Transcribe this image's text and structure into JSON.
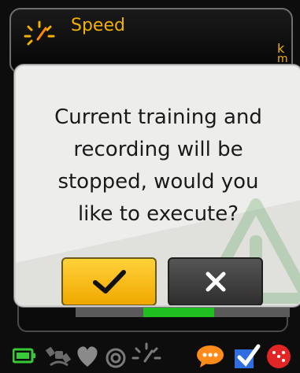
{
  "header": {
    "metric_label": "Speed",
    "metric_icon": "speed-gauge-icon",
    "unit_line1": "k",
    "unit_line2": "m"
  },
  "progress": {
    "fill_fraction": 0.33,
    "color": "#1fbf1f"
  },
  "dialog": {
    "message_lines": [
      "Current training and",
      "recording will be",
      "stopped, would you",
      "like to execute?"
    ],
    "watermark_icon": "warning-triangle-icon"
  },
  "buttons": {
    "confirm_icon": "checkmark-icon",
    "cancel_icon": "close-x-icon",
    "confirm_color": "#f7c21a",
    "cancel_color": "#3a3a3a"
  },
  "statusbar": {
    "icons": [
      "battery-icon",
      "satellite-gps-icon",
      "heart-rate-icon",
      "stopwatch-icon",
      "speed-gauge-icon",
      "chat-bubble-icon",
      "sync-icon",
      "record-icon"
    ]
  }
}
